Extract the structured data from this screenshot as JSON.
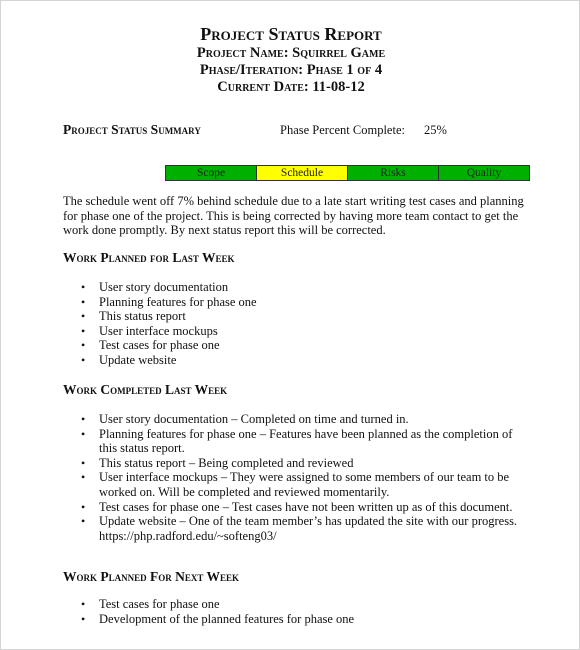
{
  "header": {
    "title": "Project Status Report",
    "project_name": "Project Name: Squirrel Game",
    "phase": "Phase/Iteration: Phase 1 of 4",
    "date": "Current Date: 11-08-12"
  },
  "summary": {
    "heading": "Project Status Summary",
    "percent_label": "Phase Percent Complete:",
    "percent_value": "25%",
    "status_bar": [
      {
        "label": "Scope",
        "status": "green",
        "color": "#00b000"
      },
      {
        "label": "Schedule",
        "status": "yellow",
        "color": "#ffff00"
      },
      {
        "label": "Risks",
        "status": "green",
        "color": "#00b000"
      },
      {
        "label": "Quality",
        "status": "green",
        "color": "#00b000"
      }
    ],
    "paragraph": "The schedule went off 7% behind schedule due to a late start writing test cases and planning for phase one of the project. This is being corrected by having more team contact to get the work done promptly. By next status report this will be corrected."
  },
  "planned_last_week": {
    "heading": "Work Planned for Last Week",
    "items": [
      "User story documentation",
      "Planning features for phase one",
      "This status report",
      "User interface mockups",
      "Test cases for phase one",
      "Update website"
    ]
  },
  "completed_last_week": {
    "heading": "Work Completed Last Week",
    "items": [
      "User story documentation – Completed on time and turned in.",
      "Planning features for phase one – Features have been planned as the completion of this status report.",
      "This status report – Being completed and reviewed",
      "User interface mockups – They were assigned to some members of our team to be worked on. Will be completed and reviewed momentarily.",
      "Test cases for phase one – Test cases have not been written up as of this document.",
      "Update website – One of the team member’s has updated the site with our progress. https://php.radford.edu/~softeng03/"
    ]
  },
  "planned_next_week": {
    "heading": "Work Planned For Next Week",
    "items": [
      "Test cases for phase one",
      "Development of the planned features for phase one"
    ]
  },
  "bullet_glyph": "•"
}
